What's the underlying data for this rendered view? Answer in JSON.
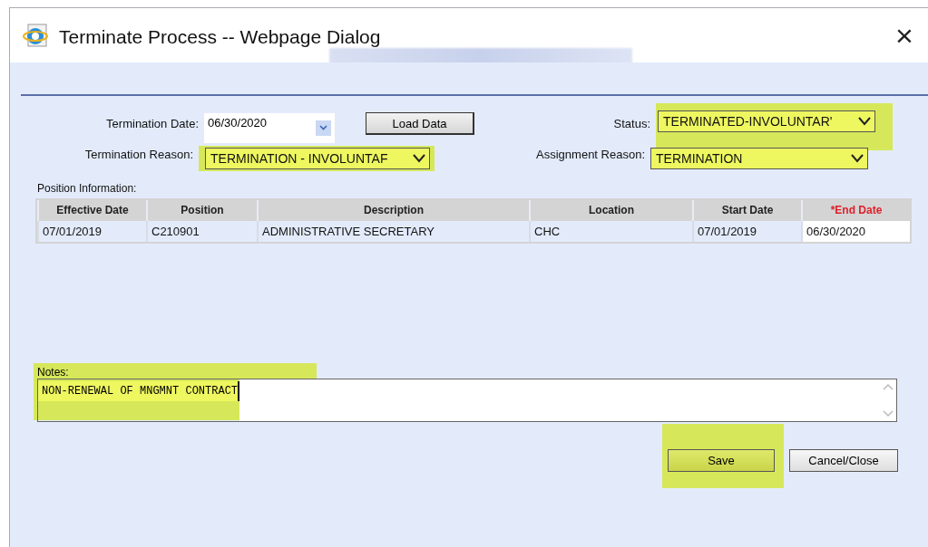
{
  "window": {
    "title": "Terminate Process -- Webpage Dialog",
    "close": "×"
  },
  "form": {
    "termination_date": {
      "label": "Termination Date:",
      "value": "06/30/2020"
    },
    "load_button": "Load Data",
    "status": {
      "label": "Status:",
      "value": "TERMINATED-INVOLUNTAR'",
      "highlighted": true
    },
    "termination_reason": {
      "label": "Termination Reason:",
      "value": "TERMINATION - INVOLUNTAF",
      "highlighted": true
    },
    "assignment_reason": {
      "label": "Assignment Reason:",
      "value": "TERMINATION",
      "highlighted": true
    }
  },
  "position_label": "Position Information:",
  "table": {
    "columns": [
      {
        "label": "Effective Date",
        "required": false
      },
      {
        "label": "Position",
        "required": false
      },
      {
        "label": "Description",
        "required": false
      },
      {
        "label": "Location",
        "required": false
      },
      {
        "label": "Start Date",
        "required": false
      },
      {
        "label": "*End Date",
        "required": true
      }
    ],
    "rows": [
      {
        "cells": [
          "07/01/2019",
          "C210901",
          "ADMINISTRATIVE SECRETARY",
          "CHC",
          "07/01/2019",
          "06/30/2020"
        ]
      }
    ]
  },
  "notes": {
    "label": "Notes:",
    "value": "NON-RENEWAL OF MNGMNT CONTRACT",
    "highlighted": true
  },
  "buttons": [
    {
      "label": "Save",
      "highlighted": true
    },
    {
      "label": "Cancel/Close",
      "highlighted": false
    }
  ]
}
